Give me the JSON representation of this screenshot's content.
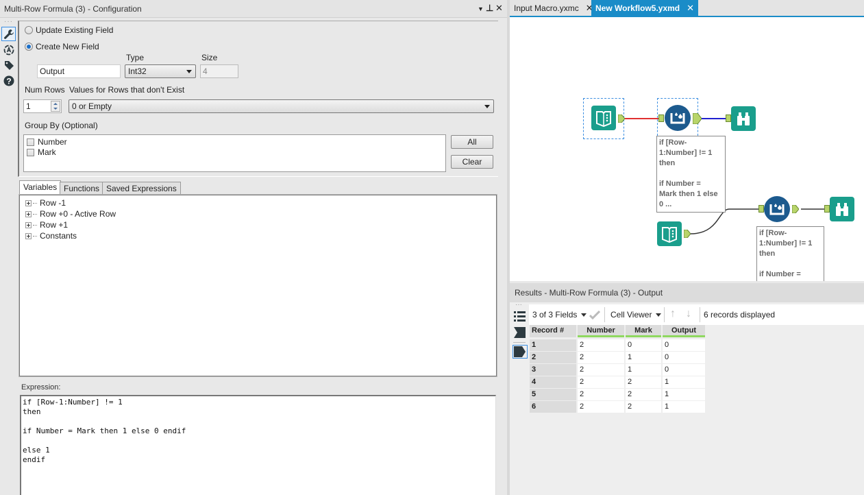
{
  "config": {
    "title": "Multi-Row Formula (3) - Configuration",
    "window_controls": [
      "dropdown",
      "pin",
      "close"
    ],
    "side_icons": [
      "wrench-icon",
      "annotation-icon",
      "tag-icon",
      "help-icon"
    ],
    "update_existing_label": "Update Existing Field",
    "create_new_label": "Create New  Field",
    "selected_mode": "create_new",
    "type_label": "Type",
    "size_label": "Size",
    "field_name_value": "Output",
    "type_value": "Int32",
    "size_value": "4",
    "num_rows_label": "Num Rows",
    "num_rows_value": "1",
    "nonexistent_label": "Values for Rows that don't Exist",
    "nonexistent_value": "0 or Empty",
    "group_by_label": "Group By (Optional)",
    "group_by_fields": [
      {
        "label": "Number",
        "checked": false
      },
      {
        "label": "Mark",
        "checked": false
      }
    ],
    "all_button": "All",
    "clear_button": "Clear",
    "tabs": [
      "Variables",
      "Functions",
      "Saved Expressions"
    ],
    "active_tab": "Variables",
    "tree_items": [
      "Row -1",
      "Row +0 - Active Row",
      "Row +1",
      "Constants"
    ],
    "expression_label": "Expression:",
    "expression": "if [Row-1:Number] != 1\nthen\n\nif Number = Mark then 1 else 0 endif\n\nelse 1\nendif"
  },
  "doc_tabs": [
    {
      "label": "Input Macro.yxmc",
      "active": false
    },
    {
      "label": "New Workflow5.yxmd",
      "active": true
    }
  ],
  "canvas": {
    "annotation_1": "if [Row-\n1:Number] != 1\nthen\n\nif Number =\nMark then 1 else\n0 ...",
    "annotation_2": "if [Row-\n1:Number] != 1\nthen\n\nif Number =",
    "colors": {
      "tool_teal": "#1a9e8c",
      "tool_blue": "#1c5a8e",
      "conn_red": "#e03030",
      "conn_blue": "#2020d0",
      "conn_dark": "#333333"
    }
  },
  "results": {
    "title": "Results - Multi-Row Formula (3) - Output",
    "fields_selector": "3 of 3 Fields",
    "viewer": "Cell Viewer",
    "records_displayed": "6 records displayed",
    "columns": [
      "Record #",
      "Number",
      "Mark",
      "Output"
    ],
    "rows": [
      [
        "1",
        "2",
        "0",
        "0"
      ],
      [
        "2",
        "2",
        "1",
        "0"
      ],
      [
        "3",
        "2",
        "1",
        "0"
      ],
      [
        "4",
        "2",
        "2",
        "1"
      ],
      [
        "5",
        "2",
        "2",
        "1"
      ],
      [
        "6",
        "2",
        "2",
        "1"
      ]
    ]
  }
}
